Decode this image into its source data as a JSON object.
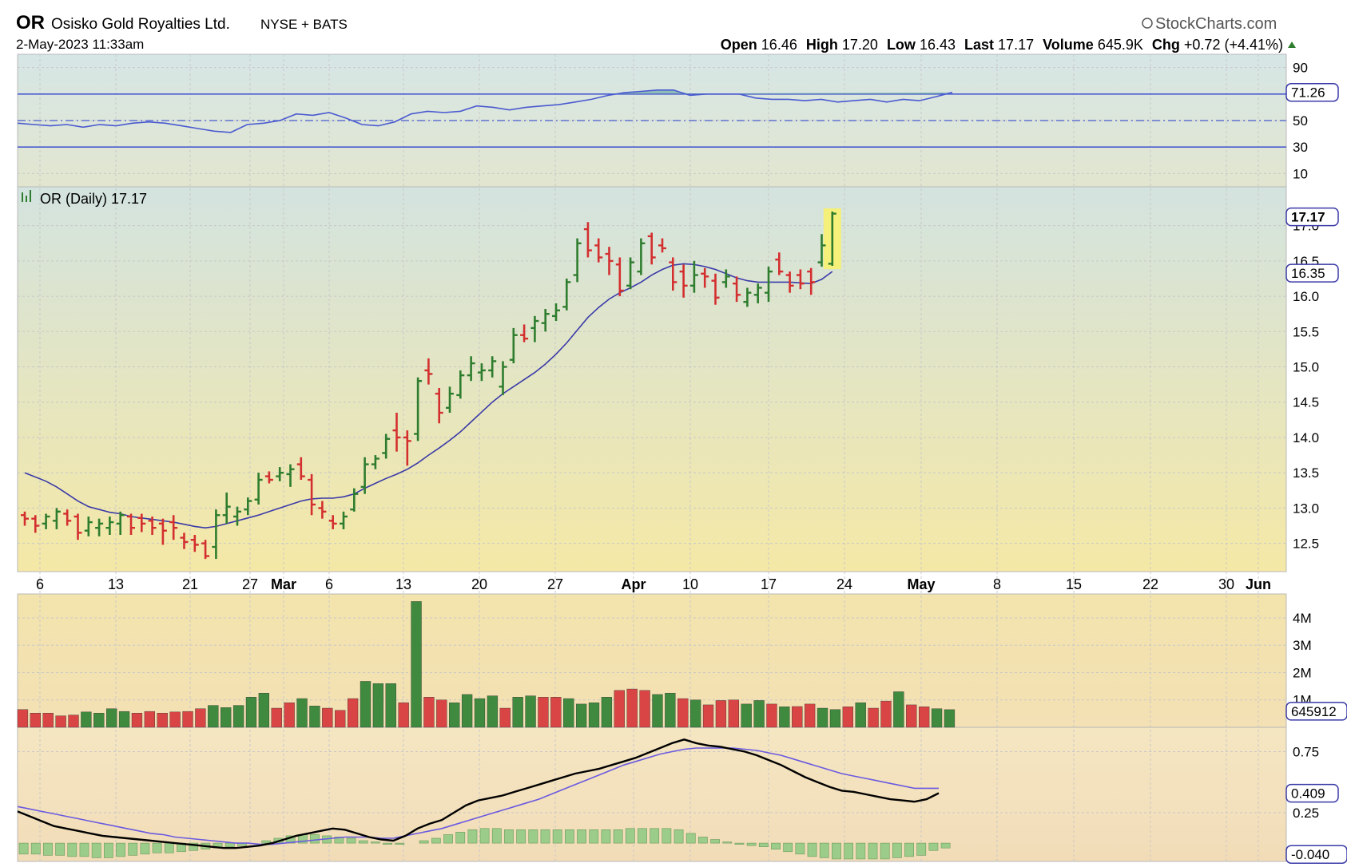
{
  "header": {
    "symbol": "OR",
    "company": "Osisko Gold Royalties Ltd.",
    "exchange": "NYSE + BATS",
    "timestamp": "2-May-2023 11:33am",
    "brand": "StockCharts.com",
    "open_label": "Open",
    "open": "16.46",
    "high_label": "High",
    "high": "17.20",
    "low_label": "Low",
    "low": "16.43",
    "last_label": "Last",
    "last": "17.17",
    "volume_label": "Volume",
    "volume": "645.9K",
    "chg_label": "Chg",
    "chg": "+0.72 (+4.41%)"
  },
  "colors": {
    "up": "#2e7d2e",
    "down": "#d32f2f",
    "ma": "#3a3aa8",
    "rsi": "#4a5ad0",
    "macd": "#000000",
    "signal": "#6a5ae0",
    "hist": "#9ccc8a",
    "vol_up": "#3f8a3f",
    "vol_down": "#d94545",
    "highlight": "#f4f07a"
  },
  "chart_data": [
    {
      "type": "line",
      "panel": "rsi",
      "y_ticks": [
        "90",
        "70",
        "50",
        "30",
        "10"
      ],
      "current_label": "71.26",
      "ylim": [
        0,
        100
      ],
      "overbought": 70,
      "oversold": 30,
      "mid": 50,
      "values": [
        48,
        47,
        46,
        47,
        45,
        47,
        46,
        48,
        49,
        48,
        46,
        44,
        42,
        41,
        47,
        48,
        50,
        55,
        54,
        56,
        52,
        47,
        46,
        49,
        55,
        57,
        56,
        57,
        61,
        60,
        58,
        60,
        61,
        62,
        64,
        66,
        69,
        71,
        72,
        73,
        73,
        69,
        70,
        70,
        70,
        67,
        66,
        66,
        65,
        66,
        64,
        65,
        66,
        64,
        66,
        65,
        68,
        71.26
      ]
    },
    {
      "type": "ohlc",
      "panel": "price",
      "title": "OR (Daily) 17.17",
      "y_ticks": [
        "17.0",
        "16.5",
        "16.0",
        "15.5",
        "15.0",
        "14.5",
        "14.0",
        "13.5",
        "13.0",
        "12.5"
      ],
      "ylim": [
        12.1,
        17.55
      ],
      "current_label": "17.17",
      "ma_label": "16.35",
      "x_tick_labels": [
        "6",
        "13",
        "21",
        "27",
        "Mar",
        "6",
        "13",
        "20",
        "27",
        "Apr",
        "10",
        "17",
        "24",
        "May",
        "8",
        "15",
        "22",
        "30",
        "Jun"
      ],
      "ohlc": [
        [
          12.9,
          12.95,
          12.75,
          12.85
        ],
        [
          12.85,
          12.9,
          12.65,
          12.75
        ],
        [
          12.78,
          12.92,
          12.7,
          12.88
        ],
        [
          12.82,
          13.0,
          12.7,
          12.95
        ],
        [
          12.92,
          12.98,
          12.75,
          12.82
        ],
        [
          12.88,
          12.92,
          12.55,
          12.65
        ],
        [
          12.68,
          12.88,
          12.6,
          12.8
        ],
        [
          12.72,
          12.85,
          12.6,
          12.78
        ],
        [
          12.72,
          12.88,
          12.62,
          12.8
        ],
        [
          12.78,
          12.95,
          12.62,
          12.9
        ],
        [
          12.88,
          12.92,
          12.62,
          12.72
        ],
        [
          12.86,
          12.92,
          12.66,
          12.78
        ],
        [
          12.82,
          12.88,
          12.62,
          12.72
        ],
        [
          12.78,
          12.85,
          12.48,
          12.68
        ],
        [
          12.8,
          12.9,
          12.55,
          12.72
        ],
        [
          12.58,
          12.65,
          12.42,
          12.52
        ],
        [
          12.55,
          12.62,
          12.38,
          12.48
        ],
        [
          12.5,
          12.55,
          12.28,
          12.32
        ],
        [
          12.45,
          12.98,
          12.28,
          12.9
        ],
        [
          12.9,
          13.22,
          12.78,
          13.02
        ],
        [
          12.88,
          13.02,
          12.75,
          12.95
        ],
        [
          12.98,
          13.15,
          12.9,
          13.1
        ],
        [
          13.12,
          13.5,
          13.05,
          13.4
        ],
        [
          13.45,
          13.52,
          13.35,
          13.4
        ],
        [
          13.45,
          13.58,
          13.38,
          13.5
        ],
        [
          13.48,
          13.62,
          13.3,
          13.55
        ],
        [
          13.62,
          13.72,
          13.4,
          13.45
        ],
        [
          13.4,
          13.48,
          12.9,
          13.05
        ],
        [
          13.0,
          13.1,
          12.85,
          12.95
        ],
        [
          12.82,
          12.9,
          12.7,
          12.78
        ],
        [
          12.78,
          12.95,
          12.7,
          12.88
        ],
        [
          12.98,
          13.28,
          12.95,
          13.2
        ],
        [
          13.3,
          13.72,
          13.2,
          13.62
        ],
        [
          13.62,
          13.75,
          13.55,
          13.7
        ],
        [
          13.78,
          14.05,
          13.7,
          13.98
        ],
        [
          14.1,
          14.35,
          13.8,
          14.0
        ],
        [
          14.0,
          14.1,
          13.6,
          13.95
        ],
        [
          14.05,
          14.85,
          13.95,
          14.8
        ],
        [
          14.95,
          15.12,
          14.75,
          14.9
        ],
        [
          14.62,
          14.7,
          14.2,
          14.35
        ],
        [
          14.42,
          14.72,
          14.35,
          14.62
        ],
        [
          14.6,
          14.95,
          14.55,
          14.88
        ],
        [
          14.88,
          15.15,
          14.8,
          15.05
        ],
        [
          14.92,
          15.05,
          14.8,
          14.95
        ],
        [
          14.95,
          15.15,
          14.85,
          15.08
        ],
        [
          14.72,
          15.08,
          14.6,
          15.0
        ],
        [
          15.1,
          15.55,
          15.05,
          15.45
        ],
        [
          15.45,
          15.6,
          15.35,
          15.4
        ],
        [
          15.55,
          15.72,
          15.35,
          15.65
        ],
        [
          15.62,
          15.82,
          15.5,
          15.75
        ],
        [
          15.72,
          15.9,
          15.65,
          15.8
        ],
        [
          15.85,
          16.25,
          15.8,
          16.2
        ],
        [
          16.3,
          16.82,
          16.2,
          16.75
        ],
        [
          16.95,
          17.05,
          16.55,
          16.65
        ],
        [
          16.72,
          16.82,
          16.48,
          16.55
        ],
        [
          16.6,
          16.7,
          16.3,
          16.5
        ],
        [
          16.45,
          16.55,
          16.0,
          16.08
        ],
        [
          16.15,
          16.55,
          16.1,
          16.48
        ],
        [
          16.35,
          16.82,
          16.3,
          16.75
        ],
        [
          16.85,
          16.9,
          16.45,
          16.55
        ],
        [
          16.72,
          16.82,
          16.62,
          16.68
        ],
        [
          16.48,
          16.55,
          16.08,
          16.2
        ],
        [
          16.35,
          16.45,
          15.98,
          16.15
        ],
        [
          16.15,
          16.5,
          16.05,
          16.3
        ],
        [
          16.32,
          16.4,
          16.12,
          16.28
        ],
        [
          16.22,
          16.32,
          15.88,
          15.98
        ],
        [
          16.2,
          16.38,
          16.12,
          16.28
        ],
        [
          16.18,
          16.28,
          15.92,
          16.02
        ],
        [
          15.92,
          16.12,
          15.85,
          16.05
        ],
        [
          16.02,
          16.18,
          15.9,
          16.12
        ],
        [
          16.05,
          16.42,
          15.92,
          16.35
        ],
        [
          16.52,
          16.62,
          16.3,
          16.35
        ],
        [
          16.3,
          16.35,
          16.05,
          16.15
        ],
        [
          16.3,
          16.38,
          16.1,
          16.18
        ],
        [
          16.35,
          16.4,
          16.02,
          16.2
        ],
        [
          16.48,
          16.88,
          16.42,
          16.72
        ],
        [
          16.46,
          17.2,
          16.43,
          17.17
        ]
      ],
      "ma": [
        13.5,
        13.44,
        13.38,
        13.3,
        13.2,
        13.1,
        13.02,
        12.98,
        12.94,
        12.92,
        12.88,
        12.86,
        12.84,
        12.82,
        12.8,
        12.77,
        12.74,
        12.72,
        12.74,
        12.78,
        12.82,
        12.86,
        12.9,
        12.95,
        13.0,
        13.05,
        13.1,
        13.13,
        13.14,
        13.14,
        13.16,
        13.2,
        13.28,
        13.35,
        13.42,
        13.48,
        13.55,
        13.64,
        13.75,
        13.85,
        13.96,
        14.08,
        14.22,
        14.36,
        14.5,
        14.62,
        14.72,
        14.82,
        14.92,
        15.04,
        15.18,
        15.34,
        15.52,
        15.7,
        15.84,
        15.96,
        16.05,
        16.12,
        16.2,
        16.3,
        16.38,
        16.44,
        16.46,
        16.45,
        16.42,
        16.38,
        16.32,
        16.26,
        16.22,
        16.2,
        16.2,
        16.2,
        16.2,
        16.19,
        16.18,
        16.24,
        16.35
      ]
    },
    {
      "type": "bar",
      "panel": "volume",
      "y_ticks": [
        "4M",
        "3M",
        "2M",
        "1M"
      ],
      "current_label": "645912",
      "ylim": [
        0,
        4700000
      ],
      "values": [
        650000,
        520000,
        520000,
        420000,
        450000,
        560000,
        520000,
        680000,
        580000,
        520000,
        580000,
        520000,
        560000,
        580000,
        680000,
        800000,
        720000,
        800000,
        1100000,
        1250000,
        700000,
        900000,
        1050000,
        780000,
        700000,
        620000,
        1050000,
        1680000,
        1600000,
        1600000,
        900000,
        4600000,
        1100000,
        1000000,
        900000,
        1200000,
        1050000,
        1150000,
        700000,
        1100000,
        1150000,
        1100000,
        1100000,
        1050000,
        850000,
        900000,
        1100000,
        1350000,
        1400000,
        1350000,
        1200000,
        1250000,
        1050000,
        1000000,
        820000,
        980000,
        1000000,
        850000,
        980000,
        850000,
        750000,
        760000,
        850000,
        700000,
        650000,
        750000,
        900000,
        700000,
        960000,
        1300000,
        820000,
        750000,
        680000,
        645912
      ],
      "up_down": [
        "d",
        "d",
        "d",
        "d",
        "d",
        "u",
        "u",
        "u",
        "u",
        "d",
        "d",
        "d",
        "d",
        "d",
        "d",
        "u",
        "u",
        "u",
        "u",
        "u",
        "d",
        "d",
        "u",
        "u",
        "d",
        "d",
        "d",
        "u",
        "u",
        "u",
        "d",
        "u",
        "d",
        "d",
        "u",
        "u",
        "u",
        "u",
        "d",
        "u",
        "u",
        "d",
        "d",
        "u",
        "u",
        "u",
        "u",
        "d",
        "d",
        "d",
        "u",
        "u",
        "d",
        "u",
        "d",
        "d",
        "d",
        "u",
        "u",
        "d",
        "u",
        "d",
        "d",
        "u",
        "u",
        "d",
        "u",
        "d",
        "d",
        "u",
        "d",
        "d",
        "u",
        "u"
      ]
    },
    {
      "type": "line",
      "panel": "macd",
      "y_ticks": [
        "0.75",
        "0.25"
      ],
      "ylim": [
        -0.15,
        0.95
      ],
      "macd_label": "0.409",
      "hist_label": "-0.040",
      "macd": [
        0.26,
        0.22,
        0.18,
        0.14,
        0.12,
        0.1,
        0.08,
        0.06,
        0.05,
        0.04,
        0.03,
        0.02,
        0.01,
        0.0,
        -0.01,
        -0.02,
        -0.03,
        -0.04,
        -0.04,
        -0.03,
        -0.02,
        0.0,
        0.03,
        0.06,
        0.08,
        0.1,
        0.12,
        0.11,
        0.08,
        0.05,
        0.03,
        0.02,
        0.06,
        0.12,
        0.16,
        0.19,
        0.25,
        0.31,
        0.35,
        0.37,
        0.39,
        0.42,
        0.45,
        0.48,
        0.51,
        0.54,
        0.57,
        0.59,
        0.61,
        0.64,
        0.67,
        0.7,
        0.74,
        0.78,
        0.82,
        0.85,
        0.82,
        0.8,
        0.79,
        0.77,
        0.75,
        0.72,
        0.68,
        0.64,
        0.59,
        0.54,
        0.5,
        0.46,
        0.43,
        0.42,
        0.4,
        0.38,
        0.36,
        0.35,
        0.34,
        0.36,
        0.41
      ],
      "signal": [
        0.3,
        0.28,
        0.26,
        0.24,
        0.22,
        0.2,
        0.18,
        0.16,
        0.14,
        0.12,
        0.1,
        0.08,
        0.07,
        0.05,
        0.04,
        0.03,
        0.02,
        0.01,
        0.0,
        0.0,
        -0.01,
        -0.01,
        0.0,
        0.01,
        0.02,
        0.03,
        0.04,
        0.05,
        0.05,
        0.05,
        0.04,
        0.04,
        0.06,
        0.08,
        0.1,
        0.12,
        0.15,
        0.18,
        0.21,
        0.24,
        0.27,
        0.3,
        0.33,
        0.36,
        0.4,
        0.44,
        0.48,
        0.52,
        0.56,
        0.6,
        0.64,
        0.67,
        0.7,
        0.73,
        0.75,
        0.77,
        0.78,
        0.78,
        0.78,
        0.78,
        0.77,
        0.76,
        0.74,
        0.72,
        0.69,
        0.66,
        0.63,
        0.6,
        0.57,
        0.55,
        0.53,
        0.51,
        0.49,
        0.47,
        0.45,
        0.45,
        0.45
      ],
      "hist": [
        -0.09,
        -0.09,
        -0.1,
        -0.1,
        -0.11,
        -0.11,
        -0.12,
        -0.12,
        -0.11,
        -0.1,
        -0.09,
        -0.08,
        -0.08,
        -0.07,
        -0.06,
        -0.05,
        -0.04,
        -0.03,
        -0.02,
        0.0,
        0.02,
        0.04,
        0.06,
        0.07,
        0.07,
        0.06,
        0.05,
        0.04,
        0.02,
        0.01,
        -0.01,
        -0.01,
        0.0,
        0.02,
        0.04,
        0.07,
        0.09,
        0.11,
        0.12,
        0.12,
        0.11,
        0.11,
        0.11,
        0.11,
        0.11,
        0.11,
        0.11,
        0.11,
        0.11,
        0.11,
        0.12,
        0.12,
        0.12,
        0.12,
        0.11,
        0.08,
        0.05,
        0.03,
        0.01,
        -0.01,
        -0.02,
        -0.03,
        -0.05,
        -0.07,
        -0.09,
        -0.11,
        -0.12,
        -0.13,
        -0.13,
        -0.13,
        -0.13,
        -0.13,
        -0.12,
        -0.11,
        -0.1,
        -0.06,
        -0.04
      ]
    }
  ]
}
